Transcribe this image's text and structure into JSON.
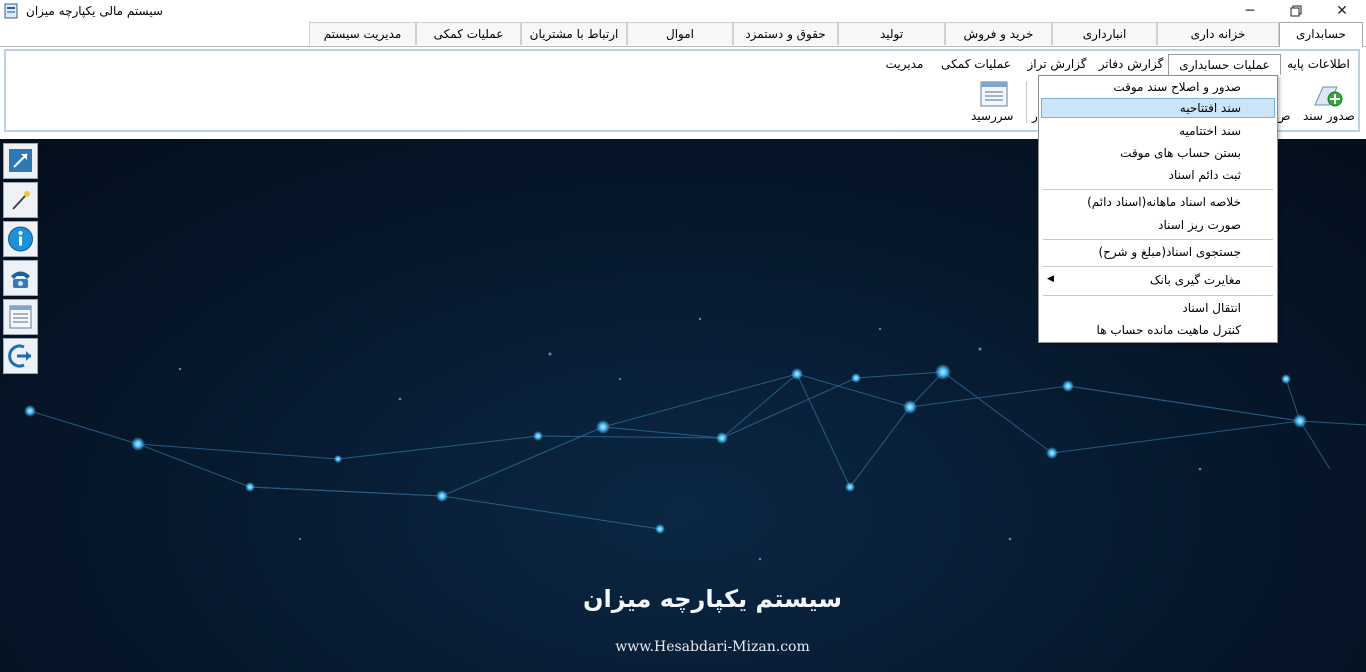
{
  "window": {
    "title": "سیستم مالی یکپارچه میزان"
  },
  "main_tabs": [
    "حسابداری",
    "خزانه داری",
    "انبارداری",
    "خرید و فروش",
    "تولید",
    "حقوق و دستمزد",
    "اموال",
    "ارتباط با مشتریان",
    "عملیات کمکی",
    "مدیریت سیستم"
  ],
  "sub_tabs": [
    "اطلاعات پایه",
    "عملیات حسابداری",
    "گزارش دفاتر",
    "گزارش تراز",
    "عملیات کمکی",
    "مدیریت"
  ],
  "ribbon": {
    "issue_voucher_label": "صدور سند",
    "issue_voucher_partial": "ص",
    "due_date_label": "سررسید",
    "partial_right_label": "ار"
  },
  "dropdown_menu": {
    "items": [
      "صدور و اصلاح سند موقت",
      "سند افتتاحیه",
      "سند اختتامیه",
      "بستن حساب های موقت",
      "ثبت دائم اسناد",
      "خلاصه اسناد ماهانه(اسناد دائم)",
      "صورت ریز اسناد",
      "جستجوی اسناد(مبلغ و شرح)",
      "مغایرت گیری بانک",
      "انتقال اسناد",
      "کنترل  ماهیت مانده حساب ها"
    ],
    "highlighted_index": 1,
    "submenu_index": 8
  },
  "desktop": {
    "brand_title": "سیستم یکپارچه میزان",
    "brand_url": "www.Hesabdari-Mizan.com"
  },
  "colors": {
    "ribbon_border": "#b9d1ea",
    "highlight": "#cce4f7",
    "desktop_bg": "#06182c",
    "node_glow": "#4fc3ff"
  },
  "icons": [
    "app-icon",
    "minimize-icon",
    "restore-icon",
    "close-icon",
    "add-document-icon",
    "calendar-notes-icon",
    "resize-arrow-icon",
    "magic-wand-icon",
    "info-icon",
    "phone-icon",
    "notes-icon",
    "exit-arrow-icon",
    "submenu-arrow-icon"
  ]
}
